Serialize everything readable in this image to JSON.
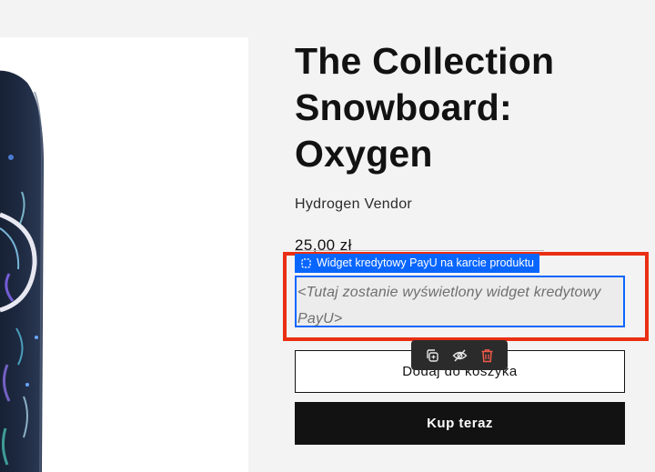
{
  "product": {
    "title": "The Collection Snowboard: Oxygen",
    "vendor": "Hydrogen Vendor",
    "price": "25,00 zł"
  },
  "editor": {
    "block_label": "Widget kredytowy PayU na karcie produktu",
    "widget_placeholder": "<Tutaj zostanie wyświetlony widget kredytowy PayU>",
    "accent_color": "#0866ff",
    "selection_color": "#ea2e12",
    "toolbar": {
      "icons": [
        "duplicate-icon",
        "hide-eye-icon",
        "delete-trash-icon"
      ]
    }
  },
  "actions": {
    "add_to_cart_label": "Dodaj do koszyka",
    "buy_now_label": "Kup teraz"
  }
}
